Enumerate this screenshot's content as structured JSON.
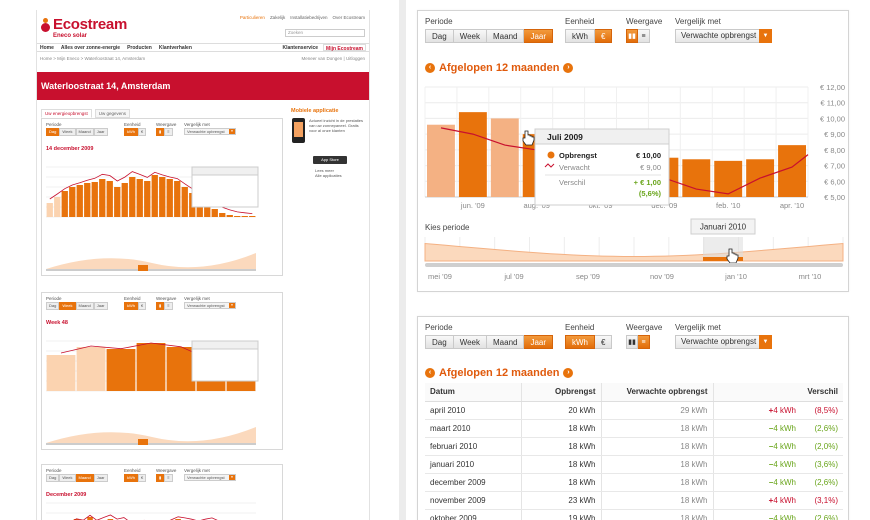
{
  "site": {
    "logo_text": "Ecostream",
    "logo_sub": "Eneco solar",
    "top_links": [
      "Particulieren",
      "Zakelijk",
      "Installatiebedrijven",
      "Over Ecostream"
    ],
    "search_placeholder": "Zoeken",
    "nav": [
      "Home",
      "Alles over zonne-energie",
      "Producten",
      "Klantverhalen"
    ],
    "nav_right": [
      "Klantenservice",
      "Mijn Ecostream"
    ],
    "breadcrumb": "Home  >  Mijn Eneco  >  Waterloostraat 14, Amsterdam",
    "user_line": "Meneer van Dongen  |  Uitloggen",
    "banner_title": "Waterloostraat 14, Amsterdam",
    "subtabs": [
      "Uw energieopbrengst",
      "Uw gegevens"
    ],
    "mobile_title": "Mobiele applicatie",
    "mobile_text": "Actueel inzicht in de prestaties van uw zonnepaneel. Gratis voor al onze klanten",
    "appstore": "App Store",
    "side_links": [
      "Lees meer",
      "Alle applicaties"
    ],
    "mini_titles": [
      "14 december 2009",
      "Week 48",
      "December 2009"
    ]
  },
  "controls": {
    "periode_label": "Periode",
    "periode_options": [
      "Dag",
      "Week",
      "Maand",
      "Jaar"
    ],
    "periode_selected": "Jaar",
    "eenheid_label": "Eenheid",
    "eenheid_options": [
      "kWh",
      "€"
    ],
    "weergave_label": "Weergave",
    "weergave_options": [
      "bar-chart-icon",
      "table-list-icon"
    ],
    "vergelijk_label": "Vergelijk met",
    "vergelijk_value": "Verwachte opbrengst"
  },
  "chart_panel": {
    "eenheid_selected": "€",
    "weergave_selected": "bar-chart-icon",
    "period_title": "Afgelopen 12 maanden",
    "tooltip": {
      "title": "Juli 2009",
      "rows": [
        {
          "label": "Opbrengst",
          "value": "€  10,00"
        },
        {
          "label": "Verwacht",
          "value": "€  9,00"
        },
        {
          "label": "Verschil",
          "value": "+ €    1,00"
        }
      ],
      "pct": "(5,6%)"
    },
    "range_label": "Januari 2010",
    "kies_periode": "Kies periode",
    "timeline_labels": [
      "mei '09",
      "jul '09",
      "sep '09",
      "nov '09",
      "jan '10",
      "mrt '10"
    ]
  },
  "chart_data": {
    "type": "bar",
    "categories": [
      "mei",
      "jun",
      "jul",
      "aug",
      "sep",
      "okt",
      "nov",
      "dec",
      "jan",
      "feb",
      "mrt",
      "apr"
    ],
    "x_tick_labels": [
      "jun. '09",
      "aug. '09",
      "okt. '09",
      "dec. '09",
      "feb. '10",
      "apr. '10"
    ],
    "series": [
      {
        "values": [
          9.4,
          9.0,
          8.3,
          8.0,
          7.0,
          6.3,
          6.0,
          6.2,
          5.5,
          5.2,
          6.2,
          6.9
        ]
      },
      {
        "values": [
          9.6,
          10.4,
          10.0,
          9.0,
          8.3,
          7.5,
          7.4,
          7.5,
          7.4,
          7.3,
          7.4,
          8.3
        ]
      }
    ],
    "highlight_index": 2,
    "y_ticks": [
      "€ 12,00",
      "€ 11,00",
      "€ 10,00",
      "€ 9,00",
      "€ 8,00",
      "€ 7,00",
      "€ 6,00",
      "€ 5,00"
    ],
    "ylim": [
      5,
      12
    ],
    "grid": true,
    "xlabel": "",
    "ylabel": ""
  },
  "table_panel": {
    "eenheid_selected": "kWh",
    "weergave_selected": "table-list-icon",
    "period_title": "Afgelopen 12 maanden",
    "headers": [
      "Datum",
      "Opbrengst",
      "Verwachte opbrengst",
      "Verschil"
    ],
    "rows": [
      {
        "date": "april 2010",
        "value": "20 kWh",
        "expected": "29 kWh",
        "sign": "+",
        "diff": "4 kWh",
        "pct": "(8,5%)",
        "dir": "pos"
      },
      {
        "date": "maart 2010",
        "value": "18 kWh",
        "expected": "18 kWh",
        "sign": "–",
        "diff": "4 kWh",
        "pct": "(2,6%)",
        "dir": "neg"
      },
      {
        "date": "februari 2010",
        "value": "18 kWh",
        "expected": "18 kWh",
        "sign": "–",
        "diff": "4 kWh",
        "pct": "(2,0%)",
        "dir": "neg"
      },
      {
        "date": "januari 2010",
        "value": "18 kWh",
        "expected": "18 kWh",
        "sign": "–",
        "diff": "4 kWh",
        "pct": "(3,6%)",
        "dir": "neg"
      },
      {
        "date": "december 2009",
        "value": "18 kWh",
        "expected": "18 kWh",
        "sign": "–",
        "diff": "4 kWh",
        "pct": "(2,6%)",
        "dir": "neg"
      },
      {
        "date": "november 2009",
        "value": "23 kWh",
        "expected": "18 kWh",
        "sign": "+",
        "diff": "4 kWh",
        "pct": "(3,1%)",
        "dir": "pos"
      },
      {
        "date": "oktober 2009",
        "value": "19 kWh",
        "expected": "18 kWh",
        "sign": "–",
        "diff": "4 kWh",
        "pct": "(2,6%)",
        "dir": "neg"
      }
    ]
  },
  "colors": {
    "accent": "#e8730c",
    "bar": "#e8730c",
    "bar_highlight": "#f4b183",
    "brand_red": "#c8102e",
    "expected_line": "#c8102e",
    "positive": "#c8102e",
    "negative": "#6aa51c"
  }
}
